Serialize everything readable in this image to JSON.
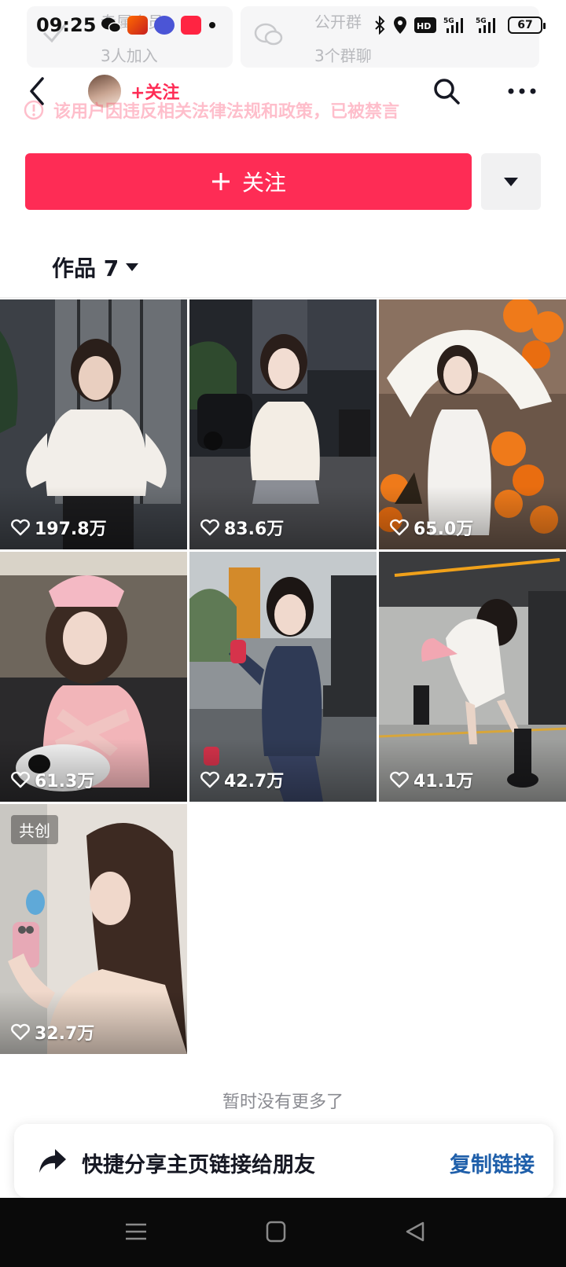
{
  "status_bar": {
    "time": "09:25",
    "app_icons": [
      "wechat-icon",
      "game-app-icon",
      "tieba-icon",
      "xiaohongshu-icon"
    ],
    "network": "5G",
    "battery": "67"
  },
  "background": {
    "group_label": "专属会员",
    "group_count": "3人加入",
    "chat_label": "公开群",
    "chat_count": "3个群聊"
  },
  "top_nav": {
    "follow_label": "+关注"
  },
  "notice": {
    "text": "该用户因违反相关法律法规和政策，已被禁言"
  },
  "follow": {
    "label": "关注"
  },
  "works": {
    "tab_label": "作品 7"
  },
  "videos": [
    {
      "likes": "197.8万",
      "cocreate": ""
    },
    {
      "likes": "83.6万",
      "cocreate": ""
    },
    {
      "likes": "65.0万",
      "cocreate": ""
    },
    {
      "likes": "61.3万",
      "cocreate": ""
    },
    {
      "likes": "42.7万",
      "cocreate": ""
    },
    {
      "likes": "41.1万",
      "cocreate": ""
    },
    {
      "likes": "32.7万",
      "cocreate": "共创"
    }
  ],
  "footer": {
    "no_more": "暂时没有更多了"
  },
  "share": {
    "text": "快捷分享主页链接给朋友",
    "copy_label": "复制链接"
  },
  "colors": {
    "accent": "#fe2c55",
    "link": "#1f5faa"
  }
}
